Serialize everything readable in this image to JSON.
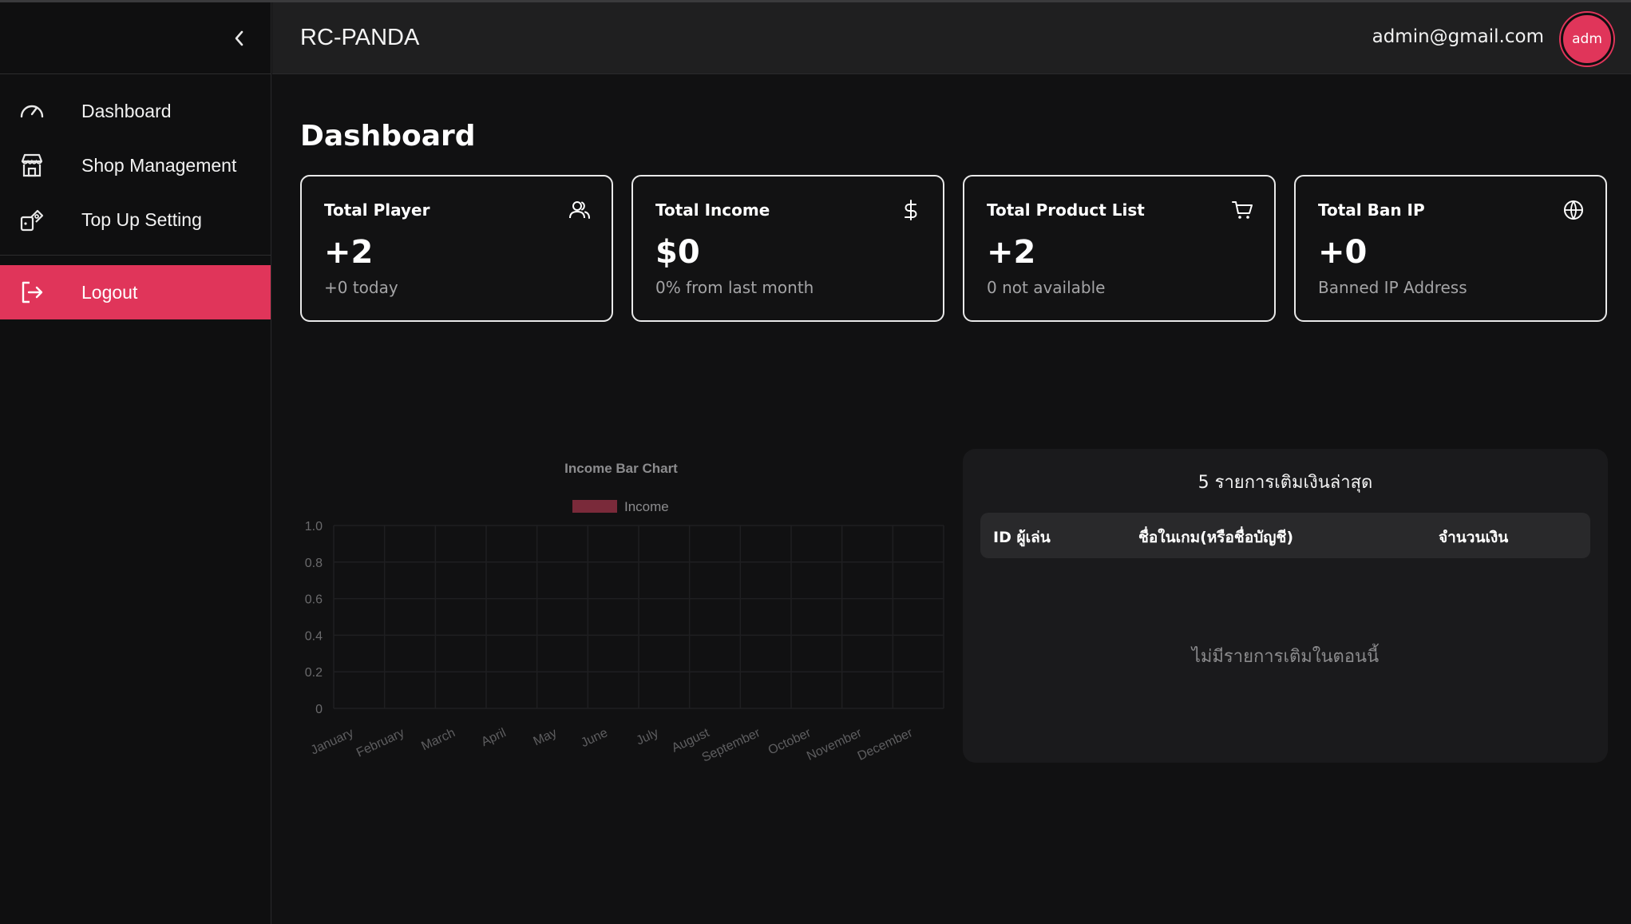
{
  "header": {
    "brand": "RC-PANDA",
    "email": "admin@gmail.com",
    "avatar": "adm"
  },
  "sidebar": {
    "items": [
      {
        "label": "Dashboard",
        "icon": "gauge-icon"
      },
      {
        "label": "Shop Management",
        "icon": "store-icon"
      },
      {
        "label": "Top Up Setting",
        "icon": "topup-icon"
      }
    ],
    "logout": {
      "label": "Logout",
      "icon": "logout-icon"
    }
  },
  "main": {
    "title": "Dashboard"
  },
  "cards": [
    {
      "title": "Total Player",
      "value": "+2",
      "sub": "+0 today",
      "icon": "users-icon"
    },
    {
      "title": "Total Income",
      "value": "$0",
      "sub": "0% from last month",
      "icon": "dollar-icon"
    },
    {
      "title": "Total Product List",
      "value": "+2",
      "sub": "0 not available",
      "icon": "cart-icon"
    },
    {
      "title": "Total Ban IP",
      "value": "+0",
      "sub": "Banned IP Address",
      "icon": "globe-icon"
    }
  ],
  "chart_data": {
    "type": "bar",
    "title": "Income Bar Chart",
    "categories": [
      "January",
      "February",
      "March",
      "April",
      "May",
      "June",
      "July",
      "August",
      "September",
      "October",
      "November",
      "December"
    ],
    "series": [
      {
        "name": "Income",
        "values": [
          0,
          0,
          0,
          0,
          0,
          0,
          0,
          0,
          0,
          0,
          0,
          0
        ]
      }
    ],
    "yticks": [
      "0",
      "0.2",
      "0.4",
      "0.6",
      "0.8",
      "1.0"
    ],
    "ylim": [
      0,
      1
    ],
    "grid": true,
    "legend": "top-center",
    "series_color": "#7a2a3a"
  },
  "table": {
    "title": "5 รายการเติมเงินล่าสุด",
    "columns": [
      "ID ผู้เล่น",
      "ชื่อในเกม(หรือชื่อบัญชี)",
      "จำนวนเงิน"
    ],
    "empty": "ไม่มีรายการเติมในตอนนี้"
  },
  "colors": {
    "accent": "#e0355a",
    "background": "#111112",
    "sidebar": "#0f0f10",
    "header": "#1f1f20"
  }
}
